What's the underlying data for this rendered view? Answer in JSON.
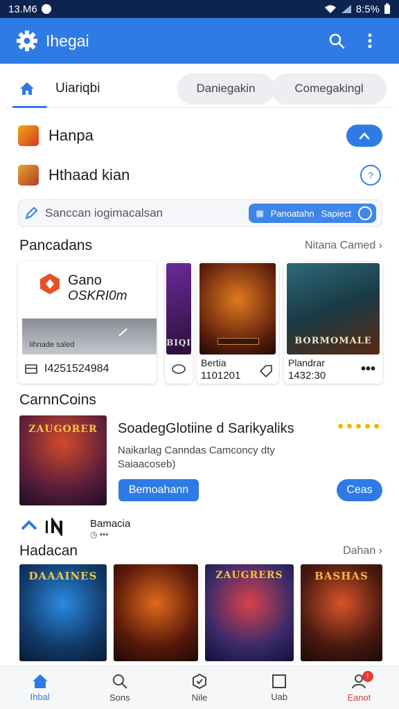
{
  "status": {
    "time": "13.M6",
    "battery": "8:5%"
  },
  "appbar": {
    "title": "Ihegai"
  },
  "tabs": {
    "home_label": "Uiariqbi",
    "tab2": "Daniegakin",
    "tab3": "Comegakingl"
  },
  "rows": [
    {
      "label": "Hanpa",
      "icon_color": "#e8a020"
    },
    {
      "label": "Hthaad kian",
      "icon_color": "#c98a1e"
    }
  ],
  "search": {
    "placeholder": "Sanccan iogimacalsan",
    "chip_left": "Panoatahn",
    "chip_right": "Sapiect"
  },
  "section1": {
    "title": "Pancadans",
    "more": "Nitana Camed"
  },
  "promo": {
    "brand_line1": "Gano",
    "brand_line2": "OSKRI0m",
    "image_caption": "Iihnade saled",
    "number": "I4251524984"
  },
  "games1": [
    {
      "art_title": "BIQI"
    },
    {
      "art_title": "",
      "name": "Bertia",
      "meta": "1101201"
    },
    {
      "art_title": "BORMOMALE",
      "name": "Plandrar",
      "meta": "1432:30"
    }
  ],
  "section2": {
    "title": "CarnnCoins"
  },
  "featured": {
    "art_title": "ZAUGORER",
    "title": "SoadegGlotiine d Sarikyaliks",
    "desc": "Naikarlag Canndas Camconcy dty Saiaacoseb)",
    "primary_button": "Bemoahann",
    "secondary_button": "Ceas"
  },
  "publisher": {
    "name": "Bamacia"
  },
  "section3": {
    "title": "Hadacan",
    "more": "Dahan"
  },
  "games2": [
    {
      "art_title": "DAAAINES"
    },
    {
      "art_title": ""
    },
    {
      "art_title": "ZAUGRERS"
    },
    {
      "art_title": "BASHAS"
    }
  ],
  "bottom_nav": [
    {
      "label": "Ihbal"
    },
    {
      "label": "Sons"
    },
    {
      "label": "Nile"
    },
    {
      "label": "Uab"
    },
    {
      "label": "Eanot",
      "badge": "!"
    }
  ],
  "colors": {
    "accent": "#2f7be6",
    "statusbar": "#0d2350",
    "rating": "#f2b705"
  }
}
